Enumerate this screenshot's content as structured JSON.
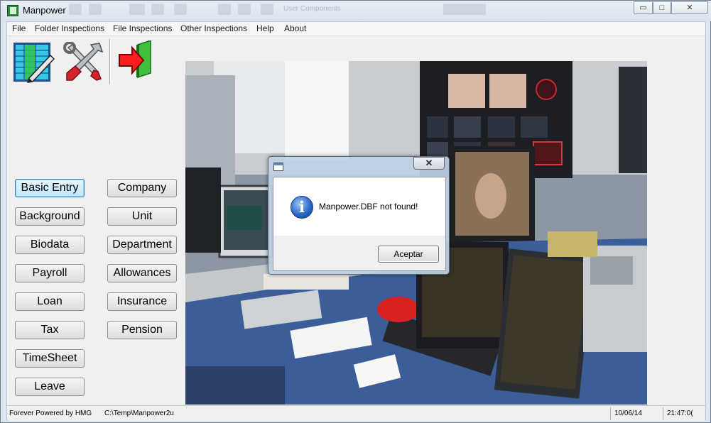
{
  "window": {
    "title": "Manpower",
    "ghost_caption": "User Components",
    "min_glyph": "▭",
    "max_glyph": "□",
    "close_glyph": "✕"
  },
  "menu": [
    "File",
    "Folder Inspections",
    "File Inspections",
    "Other Inspections",
    "Help",
    "About"
  ],
  "toolbar": {
    "icons": [
      "spreadsheet-edit-icon",
      "tools-icon",
      "exit-door-icon"
    ]
  },
  "buttons": {
    "left": [
      "Basic Entry",
      "Background",
      "Biodata",
      "Payroll",
      "Loan",
      "Tax",
      "TimeSheet",
      "Leave"
    ],
    "right": [
      "Company",
      "Unit",
      "Department",
      "Allowances",
      "Insurance",
      "Pension"
    ]
  },
  "statusbar": {
    "credit": "Forever Powered by HMG",
    "path": "C:\\Temp\\Manpower2u",
    "date": "10/06/14",
    "time": "21:47:0("
  },
  "dialog": {
    "close_glyph": "✕",
    "info_glyph": "i",
    "message": "Manpower.DBF not found!",
    "ok_label": "Aceptar"
  }
}
